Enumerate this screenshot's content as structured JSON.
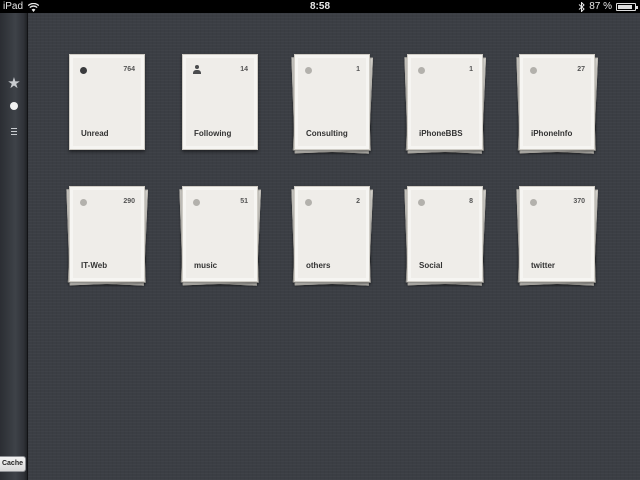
{
  "status_bar": {
    "device": "iPad",
    "time": "8:58",
    "battery": "87 %",
    "battery_level": 0.87
  },
  "sidebar": {
    "star_icon": "star-icon",
    "circle_icon": "circle-icon",
    "list_icon": "list-icon",
    "cache_label": "Cache"
  },
  "feeds": [
    {
      "label": "Unread",
      "count": "764",
      "icon": "dot-dark"
    },
    {
      "label": "Following",
      "count": "14",
      "icon": "person"
    },
    {
      "label": "Consulting",
      "count": "1",
      "icon": "dot"
    },
    {
      "label": "iPhoneBBS",
      "count": "1",
      "icon": "dot"
    },
    {
      "label": "iPhoneInfo",
      "count": "27",
      "icon": "dot"
    },
    {
      "label": "IT-Web",
      "count": "290",
      "icon": "dot"
    },
    {
      "label": "music",
      "count": "51",
      "icon": "dot"
    },
    {
      "label": "others",
      "count": "2",
      "icon": "dot"
    },
    {
      "label": "Social",
      "count": "8",
      "icon": "dot"
    },
    {
      "label": "twitter",
      "count": "370",
      "icon": "dot"
    }
  ]
}
